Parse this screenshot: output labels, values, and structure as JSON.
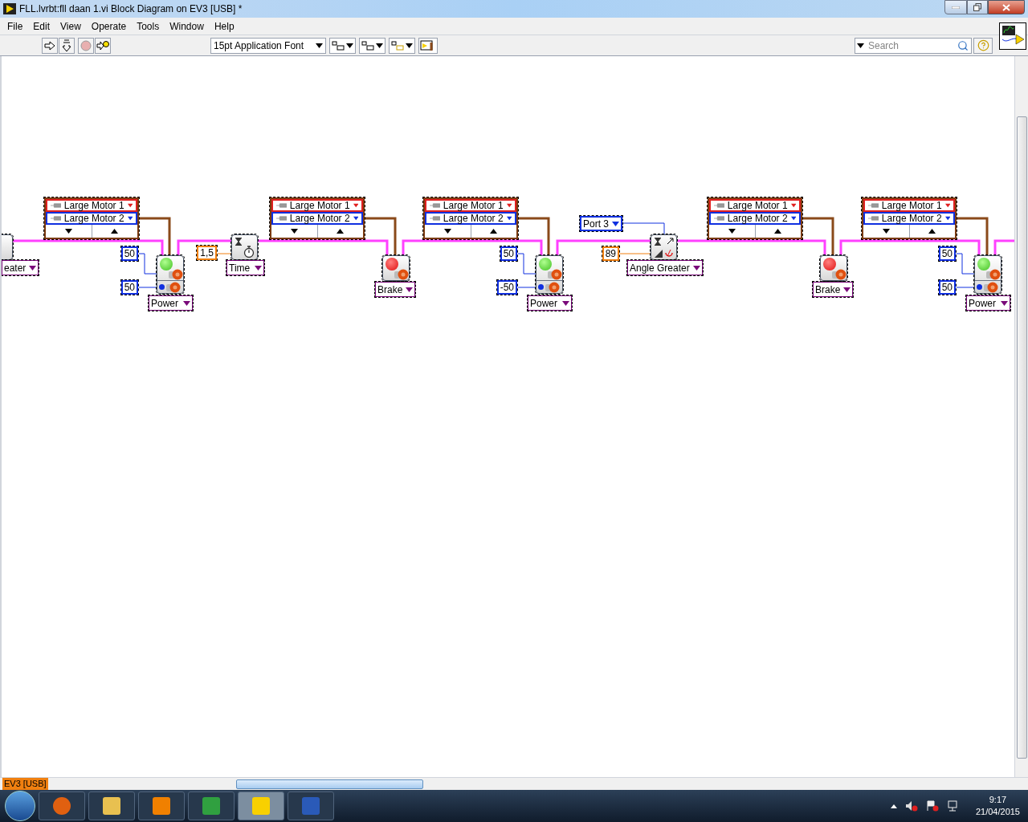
{
  "window": {
    "title": "FLL.lvrbt:fll daan 1.vi Block Diagram on EV3 [USB] *"
  },
  "menu": [
    "File",
    "Edit",
    "View",
    "Operate",
    "Tools",
    "Window",
    "Help"
  ],
  "toolbar": {
    "font": "15pt Application Font",
    "search": {
      "placeholder": "Search"
    },
    "abort_disabled": true
  },
  "blocks": [
    {
      "kind": "wait_partial",
      "mode": "eater"
    },
    {
      "kind": "move",
      "motors": [
        "Large Motor 1",
        "Large Motor 2"
      ],
      "running": true,
      "inputs": [
        "50",
        "50"
      ],
      "mode": "Power"
    },
    {
      "kind": "wait_time",
      "inputs": [
        "1,5"
      ],
      "mode": "Time"
    },
    {
      "kind": "move",
      "motors": [
        "Large Motor 1",
        "Large Motor 2"
      ],
      "running": false,
      "mode": "Brake"
    },
    {
      "kind": "move",
      "motors": [
        "Large Motor 1",
        "Large Motor 2"
      ],
      "running": true,
      "inputs": [
        "50",
        "-50"
      ],
      "mode": "Power"
    },
    {
      "kind": "wait_angle",
      "port": "Port 3",
      "inputs": [
        "89"
      ],
      "mode": "Angle Greater"
    },
    {
      "kind": "move",
      "motors": [
        "Large Motor 1",
        "Large Motor 2"
      ],
      "running": false,
      "mode": "Brake"
    },
    {
      "kind": "move",
      "motors": [
        "Large Motor 1",
        "Large Motor 2"
      ],
      "running": true,
      "inputs": [
        "50",
        "50"
      ],
      "mode": "Power"
    }
  ],
  "status_bar": {
    "target": "EV3 [USB]"
  },
  "taskbar": {
    "time": "9:17",
    "date": "21/04/2015"
  }
}
